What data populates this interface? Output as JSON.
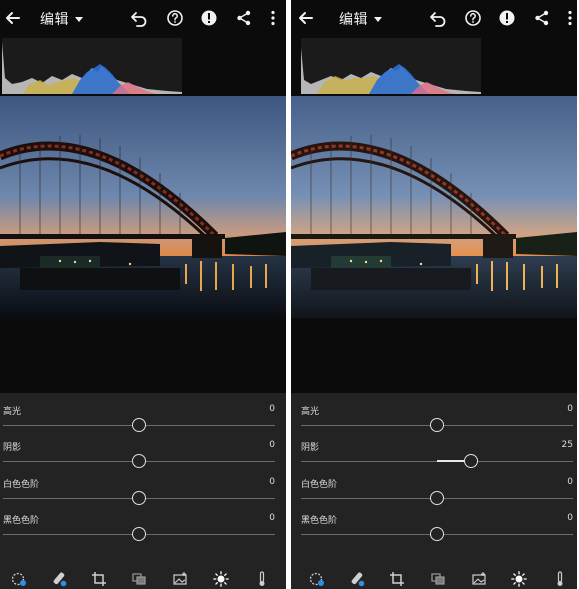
{
  "screens": [
    {
      "header": {
        "title": "编辑"
      },
      "sliders": [
        {
          "label": "高光",
          "value": "0",
          "level": 0
        },
        {
          "label": "阴影",
          "value": "0",
          "level": 0
        },
        {
          "label": "白色色阶",
          "value": "0",
          "level": 0
        },
        {
          "label": "黑色色阶",
          "value": "0",
          "level": 0
        }
      ]
    },
    {
      "header": {
        "title": "编辑"
      },
      "sliders": [
        {
          "label": "高光",
          "value": "0",
          "level": 0
        },
        {
          "label": "阴影",
          "value": "25",
          "level": 25
        },
        {
          "label": "白色色阶",
          "value": "0",
          "level": 0
        },
        {
          "label": "黑色色阶",
          "value": "0",
          "level": 0
        }
      ]
    }
  ],
  "icons": {
    "header": [
      "back-arrow-icon",
      "undo-icon",
      "help-icon",
      "alert-icon",
      "share-icon",
      "more-vert-icon"
    ],
    "toolbar": [
      "presets-icon",
      "heal-brush-icon",
      "crop-icon",
      "layers-icon",
      "selective-icon",
      "light-icon",
      "color-temp-icon"
    ]
  },
  "colors": {
    "accent": "#2f8ee6",
    "panel": "#232323",
    "background": "#0b0b0b"
  }
}
